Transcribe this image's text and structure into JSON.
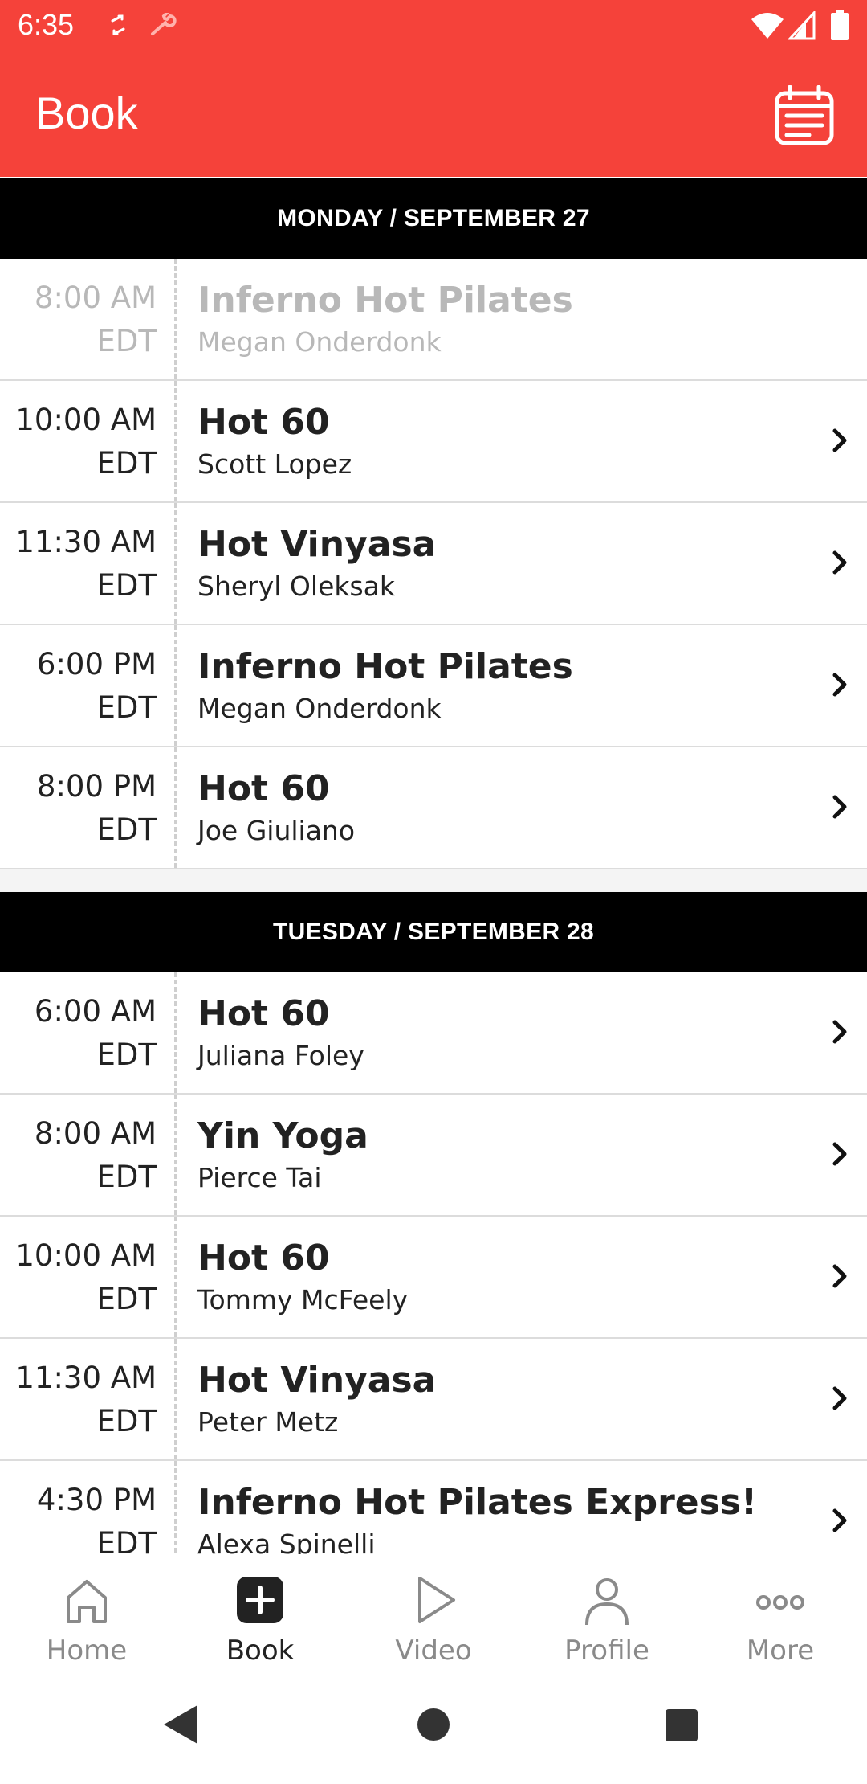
{
  "status_bar": {
    "time": "6:35"
  },
  "app_bar": {
    "title": "Book"
  },
  "days": [
    {
      "header": "MONDAY / SEPTEMBER 27",
      "classes": [
        {
          "time": "8:00 AM",
          "tz": "EDT",
          "name": "Inferno Hot Pilates",
          "instructor": "Megan Onderdonk",
          "past": true
        },
        {
          "time": "10:00 AM",
          "tz": "EDT",
          "name": "Hot 60",
          "instructor": "Scott Lopez",
          "past": false
        },
        {
          "time": "11:30 AM",
          "tz": "EDT",
          "name": "Hot Vinyasa",
          "instructor": "Sheryl Oleksak",
          "past": false
        },
        {
          "time": "6:00 PM",
          "tz": "EDT",
          "name": "Inferno Hot Pilates",
          "instructor": "Megan Onderdonk",
          "past": false
        },
        {
          "time": "8:00 PM",
          "tz": "EDT",
          "name": "Hot 60",
          "instructor": "Joe Giuliano",
          "past": false
        }
      ]
    },
    {
      "header": "TUESDAY / SEPTEMBER 28",
      "classes": [
        {
          "time": "6:00 AM",
          "tz": "EDT",
          "name": "Hot 60",
          "instructor": "Juliana Foley",
          "past": false
        },
        {
          "time": "8:00 AM",
          "tz": "EDT",
          "name": "Yin Yoga",
          "instructor": "Pierce Tai",
          "past": false
        },
        {
          "time": "10:00 AM",
          "tz": "EDT",
          "name": "Hot 60",
          "instructor": "Tommy McFeely",
          "past": false
        },
        {
          "time": "11:30 AM",
          "tz": "EDT",
          "name": "Hot Vinyasa",
          "instructor": "Peter Metz",
          "past": false
        },
        {
          "time": "4:30 PM",
          "tz": "EDT",
          "name": "Inferno Hot Pilates Express!",
          "instructor": "Alexa Spinelli",
          "past": false
        }
      ]
    }
  ],
  "bottom_nav": [
    {
      "label": "Home",
      "icon": "home-icon",
      "active": false
    },
    {
      "label": "Book",
      "icon": "plus-square-icon",
      "active": true
    },
    {
      "label": "Video",
      "icon": "play-icon",
      "active": false
    },
    {
      "label": "Profile",
      "icon": "profile-icon",
      "active": false
    },
    {
      "label": "More",
      "icon": "more-dots-icon",
      "active": false
    }
  ],
  "colors": {
    "accent": "#f5423a",
    "header_bg": "#000000",
    "past_text": "#b8b8b8"
  }
}
